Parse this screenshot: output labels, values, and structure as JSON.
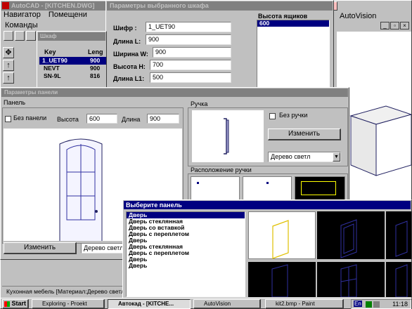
{
  "autocad_title": "AutoCAD - [KITCHEN.DWG]",
  "autocad_menu": [
    "Навигатор",
    "Помещени"
  ],
  "autocad_menu2": "Команды",
  "autovision_title": "AutoVision",
  "param_window_title": "Параметры выбранного шкафа",
  "cipher_label": "Шифр :",
  "cipher_value": "1_UET90",
  "length_label": "Длина L:",
  "length_value": "900",
  "width_label": "Ширина W:",
  "width_value": "900",
  "height_label": "Высота H:",
  "height_value": "700",
  "length1_label": "Длина L1:",
  "length1_value": "500",
  "drawer_height_label": "Высота ящиков",
  "drawer_height_items": [
    "600"
  ],
  "small_window_title": "Шкаф",
  "list_col_key": "Key",
  "list_col_length": "Leng",
  "list_rows": [
    {
      "key": "1_UET90",
      "len": "900"
    },
    {
      "key": "NEVT",
      "len": "900"
    },
    {
      "key": "SN-9L",
      "len": "816"
    }
  ],
  "door_dialog_title": "Параметры панели",
  "panel_group": "Панель",
  "no_panel_label": "Без панели",
  "height_short_label": "Высота",
  "panel_height_value": "600",
  "length_short_label": "Длина",
  "panel_length_value": "900",
  "change_button": "Изменить",
  "material_select": "Дерево светл",
  "handle_group": "Ручка",
  "no_handle_label": "Без ручки",
  "handle_change_button": "Изменить",
  "handle_material": "Дерево светл",
  "handle_position_group": "Расположение ручки",
  "select_panel_title": "Выберите панель",
  "panel_list": [
    "Дверь",
    "Дверь стеклянная",
    "Дверь со вставкой",
    "Дверь с переплетом",
    "Дверь",
    "Дверь стеклянная",
    "Дверь с переплетом",
    "Дверь",
    "Дверь"
  ],
  "status_text": "Кухонная мебель [Материал:Дерево светл",
  "taskbar": {
    "start": "Start",
    "items": [
      "Exploring - Proekt",
      "Автокад - [KITCHE...",
      "AutoVision",
      "kit2.bmp - Paint"
    ],
    "clock": "11:18",
    "lang": "En"
  },
  "colors": {
    "desktop": "#008080",
    "title_active": "#000080",
    "face": "#c0c0c0",
    "preview_yellow": "#ffff00",
    "wire_blue": "#3030a0"
  }
}
